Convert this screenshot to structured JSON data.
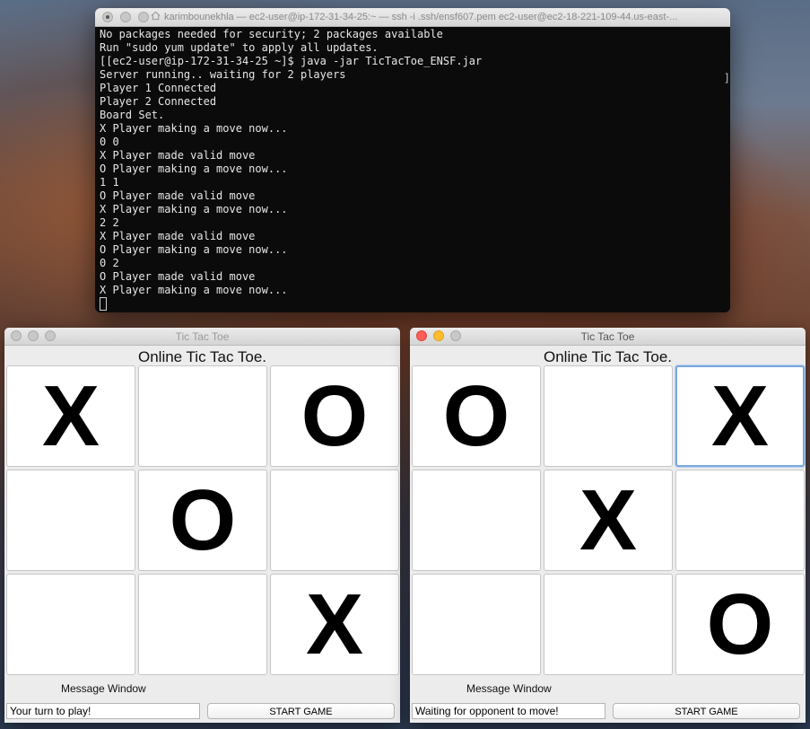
{
  "terminal": {
    "title": "karimbounekhla — ec2-user@ip-172-31-34-25:~ — ssh -i .ssh/ensf607.pem ec2-user@ec2-18-221-109-44.us-east-...",
    "lines": [
      "No packages needed for security; 2 packages available",
      "Run \"sudo yum update\" to apply all updates.",
      "[[ec2-user@ip-172-31-34-25 ~]$ java -jar TicTacToe_ENSF.jar",
      "Server running.. waiting for 2 players",
      "Player 1 Connected",
      "Player 2 Connected",
      "Board Set.",
      "X Player making a move now...",
      "0 0",
      "X Player made valid move",
      "O Player making a move now...",
      "1 1",
      "O Player made valid move",
      "X Player making a move now...",
      "2 2",
      "X Player made valid move",
      "O Player making a move now...",
      "0 2",
      "O Player made valid move",
      "X Player making a move now..."
    ],
    "right_bracket": "]"
  },
  "left_window": {
    "title": "Tic Tac Toe",
    "heading": "Online Tic Tac Toe.",
    "cells": [
      "X",
      "",
      "O",
      "",
      "O",
      "",
      "",
      "",
      "X"
    ],
    "message_label": "Message Window",
    "message": "Your turn to play!",
    "start_label": "START GAME"
  },
  "right_window": {
    "title": "Tic Tac Toe",
    "heading": "Online Tic Tac Toe.",
    "cells": [
      "O",
      "",
      "X",
      "",
      "X",
      "",
      "",
      "",
      "O"
    ],
    "message_label": "Message Window",
    "message": "Waiting for opponent to move!",
    "start_label": "START GAME"
  },
  "colors": {
    "close": "#ff5f56",
    "minimize": "#ffbd2e",
    "focus_ring": "#7aa7dd"
  }
}
